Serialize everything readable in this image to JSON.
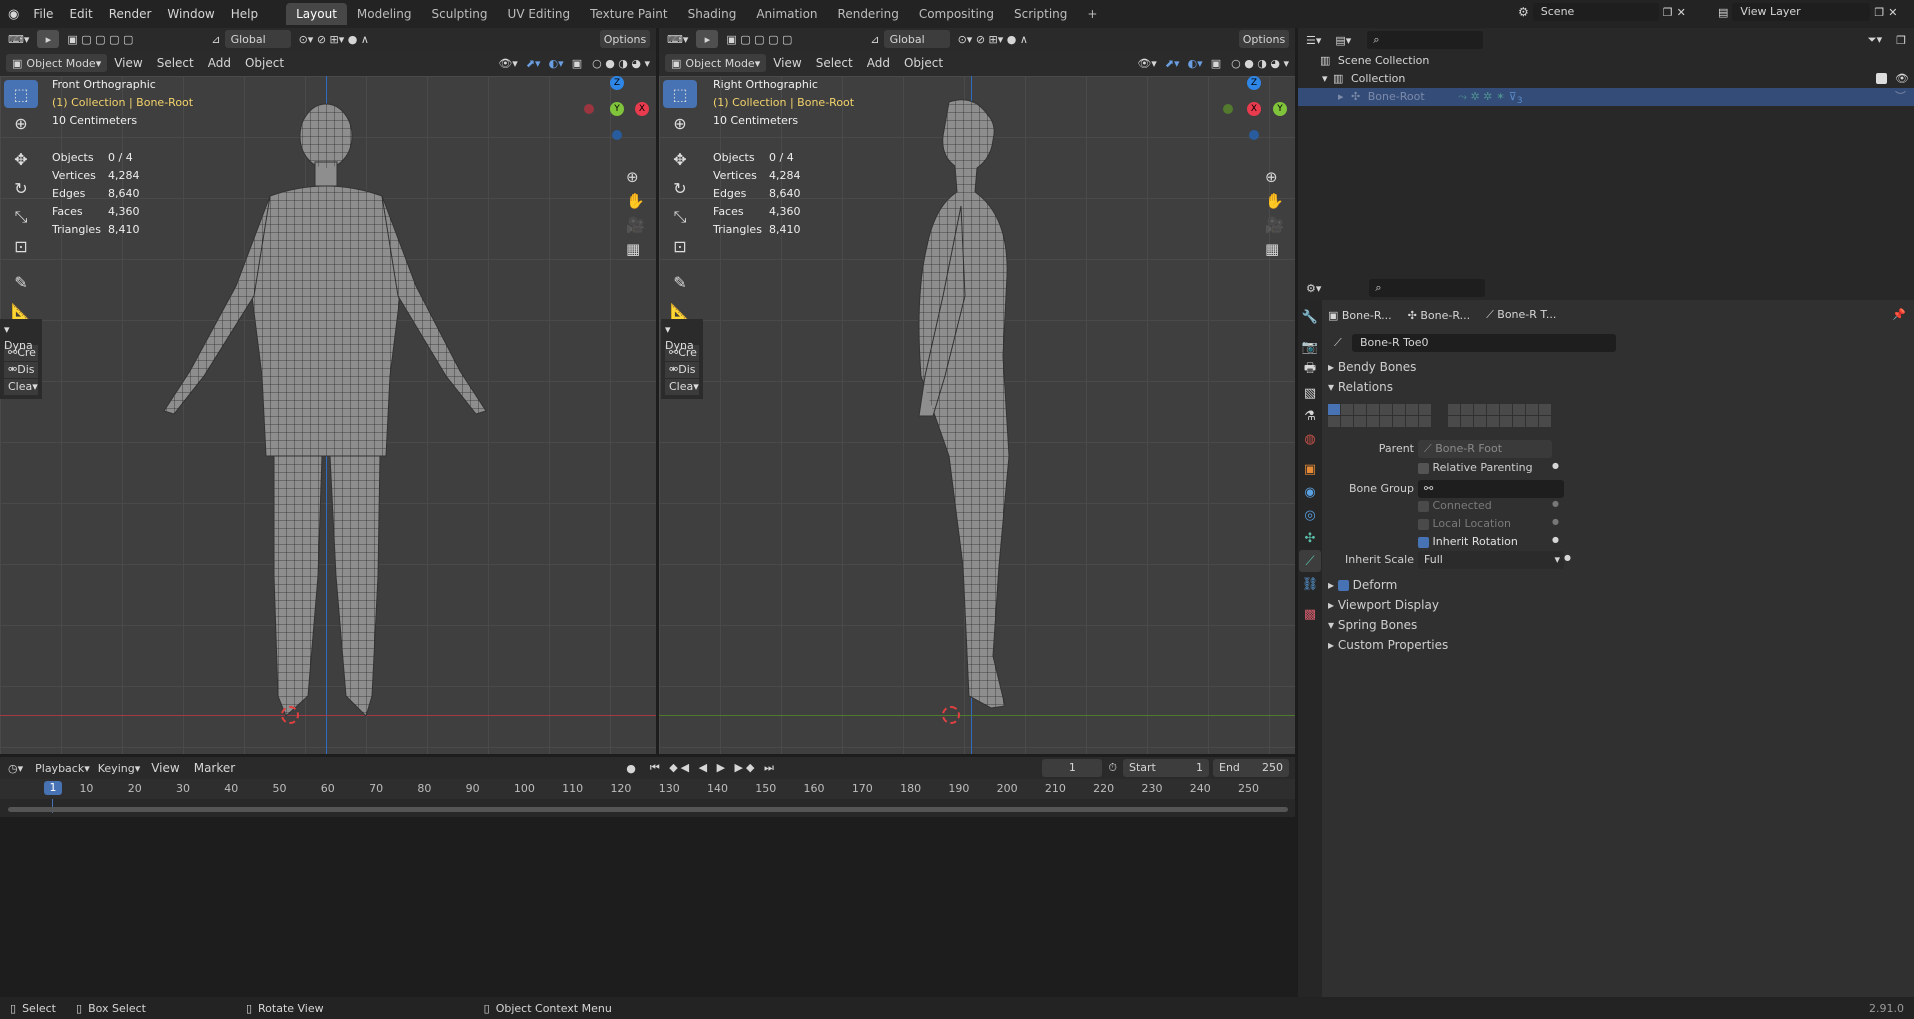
{
  "menu": {
    "items": [
      "File",
      "Edit",
      "Render",
      "Window",
      "Help"
    ]
  },
  "workspaces": [
    "Layout",
    "Modeling",
    "Sculpting",
    "UV Editing",
    "Texture Paint",
    "Shading",
    "Animation",
    "Rendering",
    "Compositing",
    "Scripting"
  ],
  "scene": {
    "name": "Scene",
    "view_layer": "View Layer"
  },
  "toolbar": {
    "orientation": "Global",
    "options": "Options"
  },
  "viewport_header": {
    "mode": "Object Mode",
    "view": "View",
    "select": "Select",
    "add": "Add",
    "object": "Object"
  },
  "left_view": {
    "title": "Front Orthographic",
    "collection": "(1) Collection | Bone-Root",
    "scale": "10 Centimeters",
    "stats": [
      {
        "label": "Objects",
        "value": "0 / 4"
      },
      {
        "label": "Vertices",
        "value": "4,284"
      },
      {
        "label": "Edges",
        "value": "8,640"
      },
      {
        "label": "Faces",
        "value": "4,360"
      },
      {
        "label": "Triangles",
        "value": "8,410"
      }
    ],
    "gizmo": {
      "z": "Z",
      "y": "Y",
      "x": "X"
    }
  },
  "right_view": {
    "title": "Right Orthographic",
    "collection": "(1) Collection | Bone-Root",
    "scale": "10 Centimeters",
    "stats": [
      {
        "label": "Objects",
        "value": "0 / 4"
      },
      {
        "label": "Vertices",
        "value": "4,284"
      },
      {
        "label": "Edges",
        "value": "8,640"
      },
      {
        "label": "Faces",
        "value": "4,360"
      },
      {
        "label": "Triangles",
        "value": "8,410"
      }
    ],
    "gizmo": {
      "z": "Z",
      "y": "Y",
      "x": "X"
    }
  },
  "dyna_panel": {
    "title": "Dyna",
    "create": "Cre",
    "dis": "Dis",
    "clear": "Clea"
  },
  "outliner": {
    "scene_collection": "Scene Collection",
    "collection": "Collection",
    "bone_root": "Bone-Root",
    "bone_count": "3"
  },
  "properties": {
    "crumbs": [
      "Bone-R...",
      "Bone-R...",
      "Bone-R T..."
    ],
    "bone_name": "Bone-R Toe0",
    "bendy_bones": "Bendy Bones",
    "relations": "Relations",
    "parent_label": "Parent",
    "parent_value": "Bone-R Foot",
    "relative_parenting": "Relative Parenting",
    "bone_group_label": "Bone Group",
    "connected": "Connected",
    "local_location": "Local Location",
    "inherit_rotation": "Inherit Rotation",
    "inherit_scale_label": "Inherit Scale",
    "inherit_scale_value": "Full",
    "deform": "Deform",
    "viewport_display": "Viewport Display",
    "spring_bones": "Spring Bones",
    "custom_properties": "Custom Properties"
  },
  "timeline": {
    "playback": "Playback",
    "keying": "Keying",
    "view": "View",
    "marker": "Marker",
    "current_frame": "1",
    "start_label": "Start",
    "start": "1",
    "end_label": "End",
    "end": "250",
    "ticks": [
      "10",
      "20",
      "30",
      "40",
      "50",
      "60",
      "70",
      "80",
      "90",
      "100",
      "110",
      "120",
      "130",
      "140",
      "150",
      "160",
      "170",
      "180",
      "190",
      "200",
      "210",
      "220",
      "230",
      "240",
      "250"
    ],
    "playhead": "1"
  },
  "statusbar": {
    "select": "Select",
    "box_select": "Box Select",
    "rotate_view": "Rotate View",
    "context_menu": "Object Context Menu",
    "version": "2.91.0"
  },
  "colors": {
    "accent": "#4772b3",
    "x_axis": "#e83b4d",
    "y_axis": "#7fc43a",
    "z_axis": "#2e86e6",
    "active_text": "#f3d36b"
  }
}
